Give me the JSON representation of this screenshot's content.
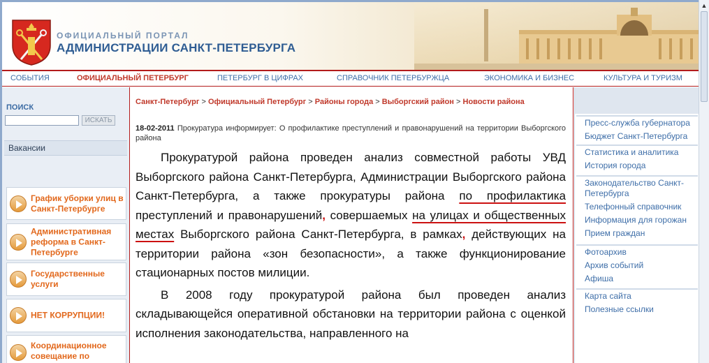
{
  "header": {
    "portal_sub": "ОФИЦИАЛЬНЫЙ ПОРТАЛ",
    "portal_main": "АДМИНИСТРАЦИИ САНКТ-ПЕТЕРБУРГА"
  },
  "nav": [
    "СОБЫТИЯ",
    "ОФИЦИАЛЬНЫЙ ПЕТЕРБУРГ",
    "ПЕТЕРБУРГ В ЦИФРАХ",
    "СПРАВОЧНИК ПЕТЕРБУРЖЦА",
    "ЭКОНОМИКА И БИЗНЕС",
    "КУЛЬТУРА И ТУРИЗМ"
  ],
  "nav_active": "ОФИЦИАЛЬНЫЙ ПЕТЕРБУРГ",
  "search": {
    "label": "ПОИСК",
    "value": "",
    "button": "ИСКАТЬ"
  },
  "sidebar": {
    "vacancy": "Вакансии",
    "promos": [
      "График уборки улиц в Санкт-Петербурге",
      "Административная реформа в Санкт-Петербурге",
      "Государственные услуги",
      "НЕТ КОРРУПЦИИ!",
      "Координационное совещание по обеспечению"
    ]
  },
  "breadcrumb": [
    "Санкт-Петербург",
    "Официальный Петербург",
    "Районы города",
    "Выборгский район",
    "Новости района"
  ],
  "breadcrumb_sep": ">",
  "news": {
    "date": "18-02-2011",
    "headline": "Прокуратура информирует: О профилактике преступлений и правонарушений на территории Выборгского района"
  },
  "article": {
    "p1_a": "Прокуратурой района проведен анализ совместной работы УВД Выборгского района Санкт-Петербурга, Администрации Выборгского района Санкт-Петербурга, а также прокуратуры района ",
    "p1_u1": "по профилактика",
    "p1_b": " преступлений и правонарушений",
    "p1_mark1": ",",
    "p1_c": " совершаемых ",
    "p1_u2": "на улицах и общественных местах",
    "p1_d": " Выборгского района Санкт-Петербурга, в рамках",
    "p1_mark2": ",",
    "p1_e": " действующих на территории района «зон безопасности», а также функционирование стационарных постов милиции.",
    "p2": "В 2008 году прокуратурой района был проведен анализ складывающейся оперативной обстановки на территории района с оценкой исполнения законодательства, направленного на"
  },
  "right_groups": [
    [
      "Пресс-служба губернатора",
      "Бюджет Санкт-Петербурга"
    ],
    [
      "Статистика и аналитика",
      "История города"
    ],
    [
      "Законодательство Санкт-Петербурга",
      "Телефонный справочник",
      "Информация для горожан",
      "Прием граждан"
    ],
    [
      "Фотоархив",
      "Архив событий",
      "Афиша"
    ],
    [
      "Карта сайта",
      "Полезные ссылки"
    ]
  ],
  "colors": {
    "brand_red": "#b31b1b",
    "link_blue": "#3e6ea8",
    "promo_orange": "#e2681c"
  }
}
